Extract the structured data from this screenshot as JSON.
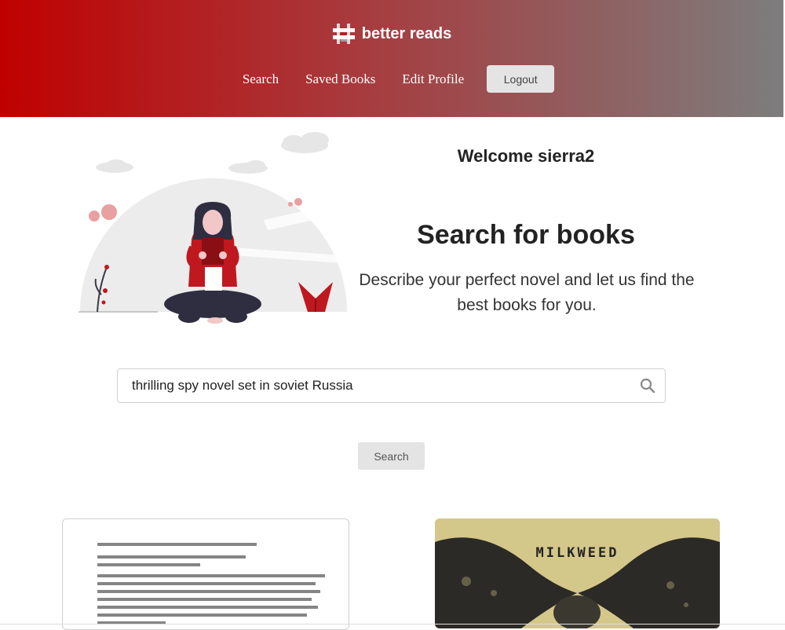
{
  "header": {
    "brand_name": "better reads",
    "nav": [
      {
        "label": "Search"
      },
      {
        "label": "Saved Books"
      },
      {
        "label": "Edit Profile"
      }
    ],
    "logout_label": "Logout"
  },
  "hero": {
    "welcome": "Welcome sierra2",
    "title": "Search for books",
    "subtitle": "Describe your perfect novel and let us find the best books for you."
  },
  "search": {
    "value": "thrilling spy novel set in soviet Russia",
    "icon": "search-icon",
    "button_label": "Search"
  },
  "results": [
    {
      "cover": "copyright-page"
    },
    {
      "cover": "illustrated",
      "cover_text": "MILKWEED"
    }
  ],
  "colors": {
    "header_start": "#c00000",
    "header_end": "#7d7d7d",
    "accent_red": "#c0181f",
    "button_bg": "#e4e4e4"
  }
}
